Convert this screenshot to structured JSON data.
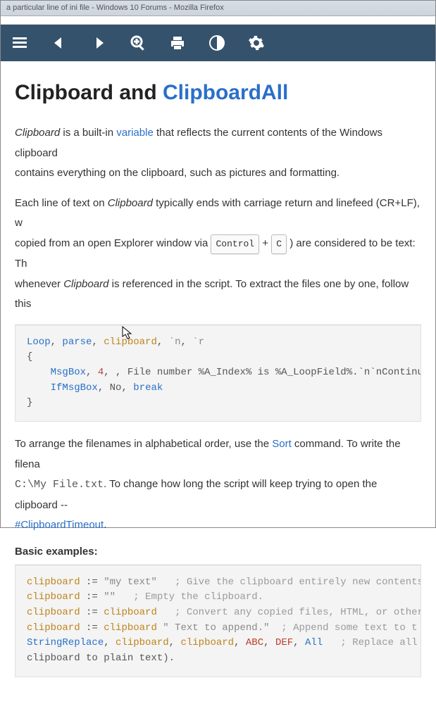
{
  "window_title": "a particular line of ini file - Windows 10 Forums - Mozilla Firefox",
  "heading": {
    "plain": "Clipboard and ",
    "link": "ClipboardAll"
  },
  "p1": {
    "t1": "Clipboard",
    "t2": " is a built-in ",
    "t3": "variable",
    "t4": " that reflects the current contents of the Windows clipboard",
    "t5": " contains everything on the clipboard, such as pictures and formatting."
  },
  "p2": {
    "t1": "Each line of text on ",
    "t2": "Clipboard",
    "t3": " typically ends with carriage return and linefeed (CR+LF), w",
    "t4": " copied from an open Explorer window via ",
    "k1": "Control",
    "plus": "+",
    "k2": "C",
    "t5": ") are considered to be text: Th",
    "t6": " whenever ",
    "t7": "Clipboard",
    "t8": " is referenced in the script. To extract the files one by one, follow this"
  },
  "code1": {
    "loop": "Loop",
    "c1": ", ",
    "parse": "parse",
    "c2": ", ",
    "clipvar": "clipboard",
    "c3": ", ",
    "bn": "`n",
    "c4": ", ",
    "br": "`r",
    "lb": "{",
    "msgbox_pad": "    ",
    "msgbox": "MsgBox",
    "msgbox_args": ", ",
    "four": "4",
    "msgbox_rest": ", , File number %A_Index% is %A_LoopField%.`n`nContinu",
    "if_pad": "    ",
    "ifmsgbox": "IfMsgBox",
    "if_c": ", ",
    "no": "No",
    "if_c2": ", ",
    "break": "break",
    "rb": "}"
  },
  "p3": {
    "t1": "To arrange the filenames in alphabetical order, use the ",
    "sort": "Sort",
    "t2": " command. To write the filena",
    "path": "C:\\My File.txt",
    "t3": ". To change how long the script will keep trying to open the clipboard --",
    "timeout": "#ClipboardTimeout",
    "t4": "."
  },
  "basic": "Basic examples:",
  "code2": {
    "cb": "clipboard",
    "asg": " := ",
    "s1": "\"my text\"",
    "cmt1": "   ; Give the clipboard entirely new contents",
    "s2": "\"\"",
    "cmt2": "   ; Empty the clipboard.",
    "cmt3": "   ; Convert any copied files, HTML, or other",
    "s4a": "\" Text to append.\"",
    "cmt4": "  ; Append some text to t",
    "srr": "StringReplace",
    "sc": ", ",
    "abc": "ABC",
    "def": "DEF",
    "all": "All",
    "cmt5": "   ; Replace all ",
    "tail": "clipboard to plain text)."
  }
}
